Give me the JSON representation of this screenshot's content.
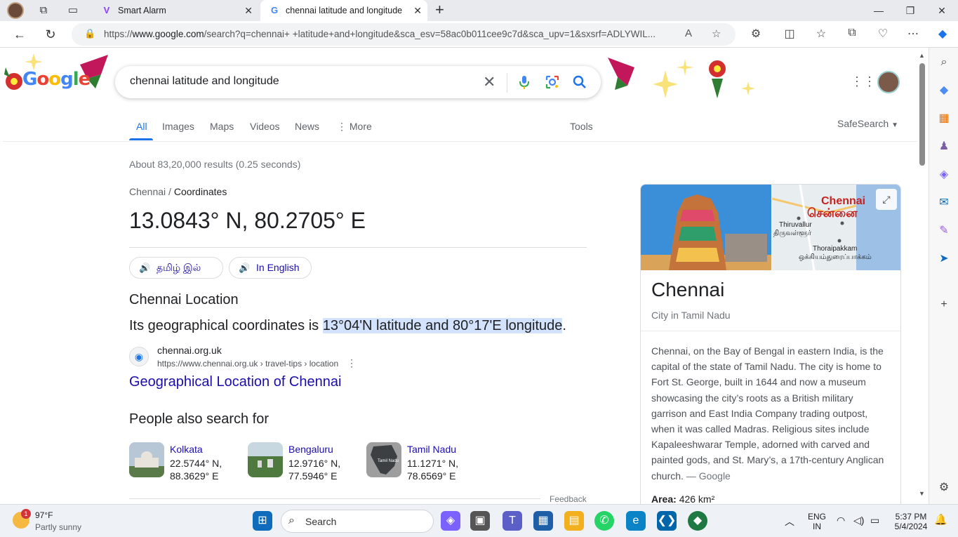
{
  "browser": {
    "tabs": [
      {
        "title": "Smart Alarm"
      },
      {
        "title": "chennai latitude and longitude -"
      }
    ],
    "url_prefix": "https://",
    "url_domain": "www.google.com",
    "url_rest": "/search?q=chennai+ +latitude+and+longitude&sca_esv=58ac0b011cee9c7d&sca_upv=1&sxsrf=ADLYWIL..."
  },
  "search": {
    "query": "chennai  latitude and longitude",
    "tabs": [
      "All",
      "Images",
      "Maps",
      "Videos",
      "News",
      "More"
    ],
    "active_tab": "All",
    "tools_label": "Tools",
    "safesearch_label": "SafeSearch"
  },
  "results": {
    "stats": "About 83,20,000 results (0.25 seconds)",
    "breadcrumb": [
      "Chennai",
      "Coordinates"
    ],
    "coordinates": "13.0843° N, 80.2705° E",
    "pill_tamil": "தமிழ் இல்",
    "pill_english": "In English",
    "location_title": "Chennai Location",
    "location_text_before": "Its geographical coordinates is ",
    "location_text_highlight": "13°04'N latitude and 80°17'E longitude",
    "location_text_after": ".",
    "source_name": "chennai.org.uk",
    "source_url": "https://www.chennai.org.uk › travel-tips › location",
    "source_link": "Geographical Location of Chennai",
    "people_also_search_title": "People also search for",
    "people_also_search": [
      {
        "name": "Kolkata",
        "lat": "22.5744° N,",
        "lon": "88.3629° E"
      },
      {
        "name": "Bengaluru",
        "lat": "12.9716° N,",
        "lon": "77.5946° E"
      },
      {
        "name": "Tamil Nadu",
        "lat": "11.1271° N,",
        "lon": "78.6569° E"
      }
    ],
    "feedback": "Feedback"
  },
  "knowledge_panel": {
    "title": "Chennai",
    "subtitle": "City in Tamil Nadu",
    "map_city": "Chennai",
    "map_city_tamil": "சென்னை",
    "map_labels": [
      "Thiruvallur",
      "திருவள்ளூர்",
      "Thoraipakkam",
      "ஒக்கியம்துரைப்பாக்கம்"
    ],
    "description": "Chennai, on the Bay of Bengal in eastern India, is the capital of the state of Tamil Nadu. The city is home to Fort St. George, built in 1644 and now a museum showcasing the city’s roots as a British military garrison and East India Company trading outpost, when it was called Madras. Religious sites include Kapaleeshwarar Temple, adorned with carved and painted gods, and St. Mary’s, a 17th-century Anglican church.",
    "description_source": "— Google",
    "area_label": "Area:",
    "area_value": "426 km²",
    "tamilnadu_thumb_label": "Tamil Nadu"
  },
  "taskbar": {
    "weather_temp": "97°F",
    "weather_desc": "Partly sunny",
    "weather_badge": "1",
    "search_label": "Search",
    "lang_line1": "ENG",
    "lang_line2": "IN",
    "time": "5:37 PM",
    "date": "5/4/2024"
  },
  "colors": {
    "link": "#1a0dab",
    "accent": "#1a73e8",
    "highlight": "#d3e3fd"
  }
}
